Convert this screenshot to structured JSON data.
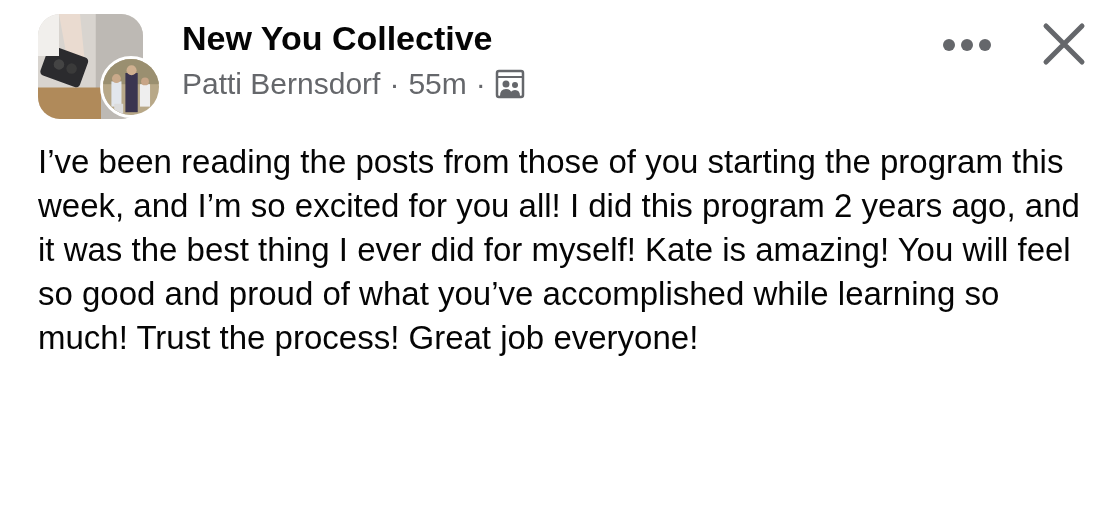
{
  "post": {
    "group_name": "New You Collective",
    "author": "Patti Bernsdorf",
    "separator_1": "·",
    "time": "55m",
    "separator_2": "·",
    "body": "I’ve been reading the posts from those of you starting the program this week, and I’m so excited for you all! I did this program 2 years ago, and it was the best thing I ever did for myself! Kate is amazing! You will feel so good and proud of what you’ve accomplished while learning so much! Trust the process! Great job everyone!"
  }
}
